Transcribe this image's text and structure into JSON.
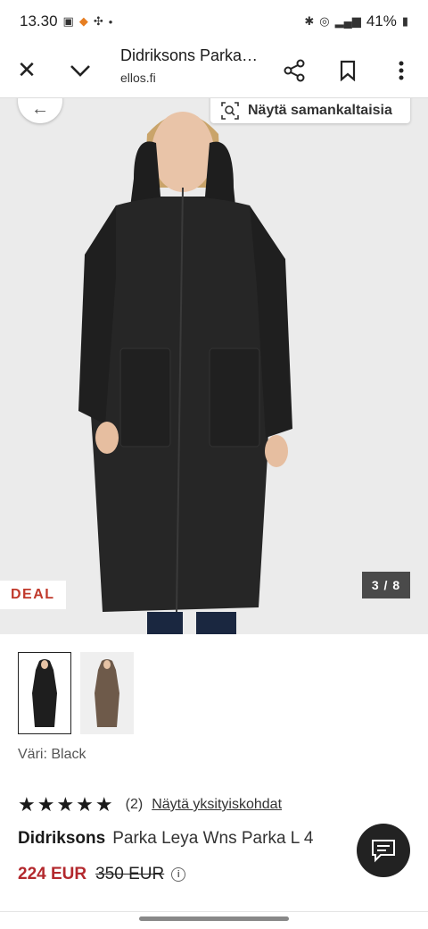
{
  "status": {
    "time": "13.30",
    "battery": "41%"
  },
  "appbar": {
    "title": "Didriksons Parka…",
    "domain": "ellos.fi"
  },
  "hero": {
    "similar_label": "Näytä samankaltaisia",
    "deal_label": "DEAL",
    "counter": "3 / 8"
  },
  "color": {
    "label": "Väri: Black"
  },
  "rating": {
    "stars": "★★★★★",
    "count": "(2)",
    "details_link": "Näytä yksityiskohdat"
  },
  "product": {
    "brand": "Didriksons",
    "name": "Parka Leya Wns Parka L 4"
  },
  "price": {
    "current": "224 EUR",
    "original": "350 EUR"
  }
}
